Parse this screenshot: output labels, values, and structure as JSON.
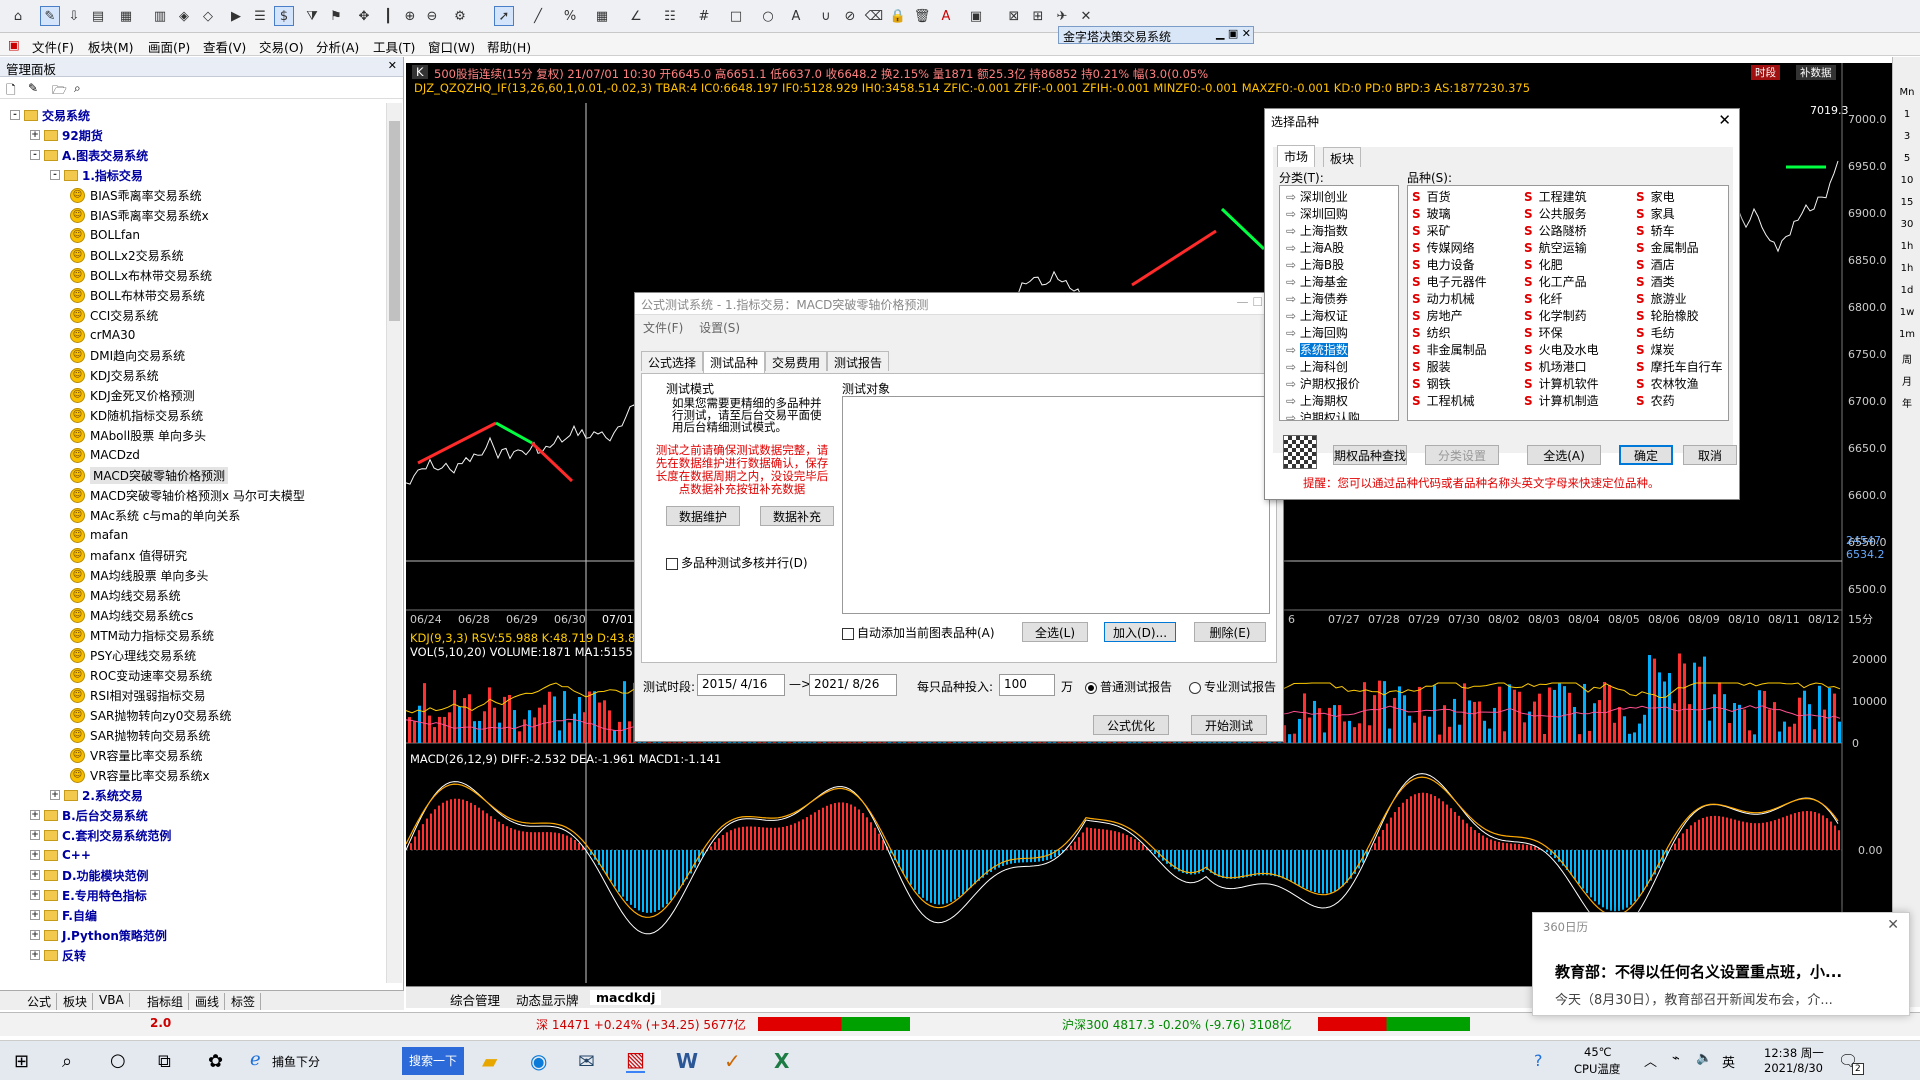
{
  "menu": [
    "文件(F)",
    "板块(M)",
    "画面(P)",
    "查看(V)",
    "交易(O)",
    "分析(A)",
    "工具(T)",
    "窗口(W)",
    "帮助(H)"
  ],
  "app_title": "金字塔决策交易系统",
  "sidebar": {
    "title": "管理面板",
    "tree": [
      {
        "label": "交易系统",
        "level": 0,
        "type": "folder",
        "exp": "-",
        "blue": true
      },
      {
        "label": "92期货",
        "level": 1,
        "type": "folder",
        "exp": "+",
        "blue": true
      },
      {
        "label": "A.图表交易系统",
        "level": 1,
        "type": "folder",
        "exp": "-",
        "blue": true
      },
      {
        "label": "1.指标交易",
        "level": 2,
        "type": "folder",
        "exp": "-",
        "blue": true
      },
      {
        "label": "BIAS乖离率交易系统",
        "level": 3,
        "type": "item"
      },
      {
        "label": "BIAS乖离率交易系统x",
        "level": 3,
        "type": "item"
      },
      {
        "label": "BOLLfan",
        "level": 3,
        "type": "item"
      },
      {
        "label": "BOLLx2交易系统",
        "level": 3,
        "type": "item"
      },
      {
        "label": "BOLLx布林带交易系统",
        "level": 3,
        "type": "item"
      },
      {
        "label": "BOLL布林带交易系统",
        "level": 3,
        "type": "item"
      },
      {
        "label": "CCI交易系统",
        "level": 3,
        "type": "item"
      },
      {
        "label": "crMA30",
        "level": 3,
        "type": "item"
      },
      {
        "label": "DMI趋向交易系统",
        "level": 3,
        "type": "item"
      },
      {
        "label": "KDJ交易系统",
        "level": 3,
        "type": "item"
      },
      {
        "label": "KDJ金死叉价格预测",
        "level": 3,
        "type": "item"
      },
      {
        "label": "KD随机指标交易系统",
        "level": 3,
        "type": "item"
      },
      {
        "label": "MAboll股票 单向多头",
        "level": 3,
        "type": "item"
      },
      {
        "label": "MACDzd",
        "level": 3,
        "type": "item"
      },
      {
        "label": "MACD突破零轴价格预测",
        "level": 3,
        "type": "item",
        "selected": true
      },
      {
        "label": "MACD突破零轴价格预测x 马尔可夫模型",
        "level": 3,
        "type": "item"
      },
      {
        "label": "MAc系统 c与ma的单向关系",
        "level": 3,
        "type": "item"
      },
      {
        "label": "mafan",
        "level": 3,
        "type": "item"
      },
      {
        "label": "mafanx 值得研究",
        "level": 3,
        "type": "item"
      },
      {
        "label": "MA均线股票 单向多头",
        "level": 3,
        "type": "item"
      },
      {
        "label": "MA均线交易系统",
        "level": 3,
        "type": "item"
      },
      {
        "label": "MA均线交易系统cs",
        "level": 3,
        "type": "item"
      },
      {
        "label": "MTM动力指标交易系统",
        "level": 3,
        "type": "item"
      },
      {
        "label": "PSY心理线交易系统",
        "level": 3,
        "type": "item"
      },
      {
        "label": "ROC变动速率交易系统",
        "level": 3,
        "type": "item"
      },
      {
        "label": "RSI相对强弱指标交易",
        "level": 3,
        "type": "item"
      },
      {
        "label": "SAR抛物转向zy0交易系统",
        "level": 3,
        "type": "item"
      },
      {
        "label": "SAR抛物转向交易系统",
        "level": 3,
        "type": "item"
      },
      {
        "label": "VR容量比率交易系统",
        "level": 3,
        "type": "item"
      },
      {
        "label": "VR容量比率交易系统x",
        "level": 3,
        "type": "item"
      },
      {
        "label": "2.系统交易",
        "level": 2,
        "type": "folder",
        "exp": "+",
        "blue": true
      },
      {
        "label": "B.后台交易系统",
        "level": 1,
        "type": "folder",
        "exp": "+",
        "blue": true
      },
      {
        "label": "C.套利交易系统范例",
        "level": 1,
        "type": "folder",
        "exp": "+",
        "blue": true
      },
      {
        "label": "C++",
        "level": 1,
        "type": "folder",
        "exp": "+",
        "blue": true
      },
      {
        "label": "D.功能模块范例",
        "level": 1,
        "type": "folder",
        "exp": "+",
        "blue": true
      },
      {
        "label": "E.专用特色指标",
        "level": 1,
        "type": "folder",
        "exp": "+",
        "blue": true
      },
      {
        "label": "F.自编",
        "level": 1,
        "type": "folder",
        "exp": "+",
        "blue": true
      },
      {
        "label": "J.Python策略范例",
        "level": 1,
        "type": "folder",
        "exp": "+",
        "blue": true
      },
      {
        "label": "反转",
        "level": 1,
        "type": "folder",
        "exp": "+",
        "blue": true
      }
    ],
    "tabs": [
      "公式",
      "板块",
      "VBA",
      "指标组",
      "画线",
      "标签"
    ]
  },
  "chart": {
    "header1": "500股指连续(15分 复权) 21/07/01 10:30 开6645.0 高6651.1 低6637.0 收6648.2 换2.15% 量1871 额25.3亿 持86852 持0.21% 幅(3.0(0.05%",
    "header2": "DJZ_QZQZHQ_IF(13,26,60,1,0.01,-0.02,3) TBAR:4 IC0:6648.197 IF0:5128.929 IH0:3458.514 ZFIC:-0.001 ZFIF:-0.001 ZFIH:-0.001 MINZF0:-0.001 MAXZF0:-0.001 KD:0 PD:0 BPD:3 AS:1877230.375",
    "price_ticks": [
      "7000.0",
      "6950.0",
      "6900.0",
      "6850.0",
      "6800.0",
      "6750.0",
      "6700.0",
      "6650.0",
      "6600.0",
      "6550.0",
      "6500.0"
    ],
    "price_marks": [
      "7019.3",
      "6499.2",
      "24547",
      "6534.2"
    ],
    "dates_left": [
      "06/24",
      "06/28",
      "06/29",
      "06/30",
      "07/01 11"
    ],
    "dates_right": [
      "6",
      "07/27",
      "07/28",
      "07/29",
      "07/30",
      "08/02",
      "08/03",
      "08/04",
      "08/05",
      "08/06",
      "08/09",
      "08/10",
      "08/11",
      "08/12",
      "15分"
    ],
    "kdj_header": "KDJ(9,3,3) RSV:55.988 K:48.719 D:43.8",
    "vol_header": "VOL(5,10,20) VOLUME:1871 MA1:5155.2",
    "vol_ticks": [
      "20000",
      "10000",
      "0"
    ],
    "macd_header": "MACD(26,12,9) DIFF:-2.532 DEA:-1.961 MACD1:-1.141",
    "macd_zero": "0.00",
    "top_right_btns": [
      "时段",
      "补数据"
    ]
  },
  "bottom_tabs": [
    "综合管理",
    "动态显示牌",
    "macdkdj"
  ],
  "status": {
    "sz": "深 14471 +0.24% (+34.25) 5677亿",
    "hs": "沪深300  4817.3 -0.20% (-9.76) 3108亿",
    "tile_num": "2.0"
  },
  "taskbar": {
    "app1": "捕鱼下分",
    "search_btn": "搜索一下",
    "temp": "45℃",
    "cpu": "CPU温度",
    "time": "12:38 周一",
    "date": "2021/8/30",
    "ime": "英",
    "badge": "2"
  },
  "dlg_test": {
    "title": "公式测试系统 - 1.指标交易：MACD突破零轴价格预测",
    "menu": [
      "文件(F)",
      "设置(S)"
    ],
    "tabs": [
      "公式选择",
      "测试品种",
      "交易费用",
      "测试报告"
    ],
    "mode_label": "测试模式",
    "mode_desc": "如果您需要更精细的多品种并行测试，请至后台交易平面使用后台精细测试模式。",
    "warn": "测试之前请确保测试数据完整，请先在数据维护进行数据确认，保存长度在数据周期之内，没设完毕后点数据补充按钮补充数据",
    "btn_maint": "数据维护",
    "btn_supp": "数据补充",
    "multi_label": "多品种测试多核并行(D)",
    "obj_label": "测试对象",
    "auto_label": "自动添加当前图表品种(A)",
    "btn_all": "全选(L)",
    "btn_add": "加入(D)...",
    "btn_del": "删除(E)",
    "period_label": "测试时段:",
    "date_from": "2015/ 4/16",
    "date_to": "2021/ 8/26",
    "invest_label": "每只品种投入:",
    "invest_val": "100",
    "invest_unit": "万",
    "r_normal": "普通测试报告",
    "r_pro": "专业测试报告",
    "btn_opt": "公式优化",
    "btn_start": "开始测试"
  },
  "dlg_sel": {
    "title": "选择品种",
    "tabs": [
      "市场",
      "板块"
    ],
    "cat_label": "分类(T):",
    "items_label": "品种(S):",
    "cats": [
      "深圳创业",
      "深圳回购",
      "上海指数",
      "上海A股",
      "上海B股",
      "上海基金",
      "上海债券",
      "上海权证",
      "上海回购",
      "系统指数",
      "上海科创",
      "沪期权报价",
      "上海期权",
      "沪期权认购"
    ],
    "cat_selected": "系统指数",
    "col1": [
      "百货",
      "玻璃",
      "采矿",
      "传媒网络",
      "电力设备",
      "电子元器件",
      "动力机械",
      "房地产",
      "纺织",
      "非金属制品",
      "服装",
      "钢铁",
      "工程机械"
    ],
    "col2": [
      "工程建筑",
      "公共服务",
      "公路隧桥",
      "航空运输",
      "化肥",
      "化工产品",
      "化纤",
      "化学制药",
      "环保",
      "火电及水电",
      "机场港口",
      "计算机软件",
      "计算机制造"
    ],
    "col3": [
      "家电",
      "家具",
      "轿车",
      "金属制品",
      "酒店",
      "酒类",
      "旅游业",
      "轮胎橡胶",
      "毛纺",
      "煤炭",
      "摩托车自行车",
      "农林牧渔",
      "农药"
    ],
    "search_btn": "期权品种查找",
    "btn_cat": "分类设置",
    "btn_all": "全选(A)",
    "btn_ok": "确定",
    "btn_cancel": "取消",
    "tip": "提醒：您可以通过品种代码或者品种名称头英文字母来快速定位品种。"
  },
  "notif": {
    "app": "360日历",
    "title": "教育部：不得以任何名义设置重点班，小...",
    "body": "今天（8月30日），教育部召开新闻发布会，介..."
  },
  "right_tools": [
    "Mn",
    "1",
    "3",
    "5",
    "10",
    "15",
    "30",
    "1h",
    "1h",
    "1d",
    "1w",
    "1m",
    "周",
    "月",
    "年"
  ],
  "colors": {
    "up": "#ff2a2a",
    "down": "#00c0c0",
    "macd_up": "#ff3030",
    "macd_dn": "#00b8ff",
    "accent": "#0050ff"
  }
}
